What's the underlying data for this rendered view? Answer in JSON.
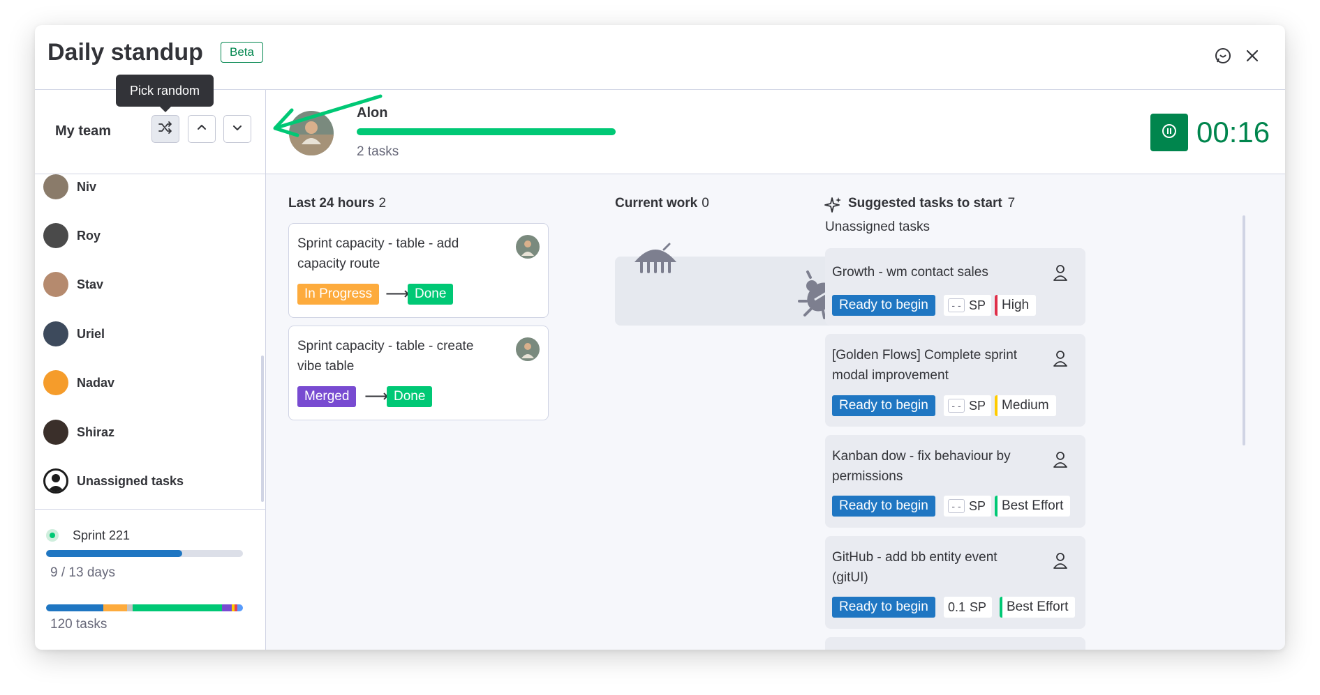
{
  "header": {
    "title": "Daily standup",
    "badge": "Beta"
  },
  "team": {
    "label": "My team",
    "tooltip": "Pick random",
    "members": [
      {
        "name": "Niv",
        "color": "#8a7b6a"
      },
      {
        "name": "Roy",
        "color": "#4a4a4a"
      },
      {
        "name": "Stav",
        "color": "#b58a6e"
      },
      {
        "name": "Uriel",
        "color": "#3d4a5c"
      },
      {
        "name": "Nadav",
        "color": "#f59c2b"
      },
      {
        "name": "Shiraz",
        "color": "#3a2f2a"
      },
      {
        "name": "Unassigned tasks",
        "color": "#1c1c1c"
      }
    ]
  },
  "sprint": {
    "name": "Sprint 221",
    "days": "9 / 13 days",
    "days_progress": 0.69,
    "tasks": "120 tasks"
  },
  "current_person": {
    "name": "Alon",
    "tasks": "2 tasks",
    "timer": "00:16"
  },
  "columns": {
    "last24": {
      "label": "Last 24 hours",
      "count": "2"
    },
    "current": {
      "label": "Current work",
      "count": "0"
    },
    "suggested": {
      "label": "Suggested tasks to start",
      "count": "7",
      "subtitle": "Unassigned tasks"
    }
  },
  "last24_cards": [
    {
      "title": "Sprint capacity - table - add capacity route",
      "from": "In Progress",
      "to": "Done"
    },
    {
      "title": "Sprint capacity - table - create vibe table",
      "from": "Merged",
      "to": "Done"
    }
  ],
  "suggested_cards": [
    {
      "title": "Growth - wm contact sales",
      "status": "Ready to begin",
      "sp_value": "- -",
      "sp_label": "SP",
      "priority": "High"
    },
    {
      "title": "[Golden Flows] Complete sprint modal improvement",
      "status": "Ready to begin",
      "sp_value": "- -",
      "sp_label": "SP",
      "priority": "Medium"
    },
    {
      "title": "Kanban dow - fix behaviour by permissions",
      "status": "Ready to begin",
      "sp_value": "- -",
      "sp_label": "SP",
      "priority": "Best Effort"
    },
    {
      "title": "GitHub - add bb entity event (gitUI)",
      "status": "Ready to begin",
      "sp_value": "0.1",
      "sp_label": "SP",
      "priority": "Best Effort"
    }
  ],
  "colors": {
    "accent": "#00854d",
    "done": "#00c875",
    "in_progress": "#fdab3d",
    "merged": "#784bd1",
    "ready": "#1f76c2",
    "high": "#df2f4a",
    "medium": "#ffcb00",
    "best_effort": "#00c875"
  },
  "icons": [
    "chat-icon",
    "close-icon",
    "shuffle-icon",
    "chevron-up-icon",
    "chevron-down-icon",
    "pause-icon",
    "sparkle-icon",
    "person-icon",
    "bug-icon"
  ]
}
